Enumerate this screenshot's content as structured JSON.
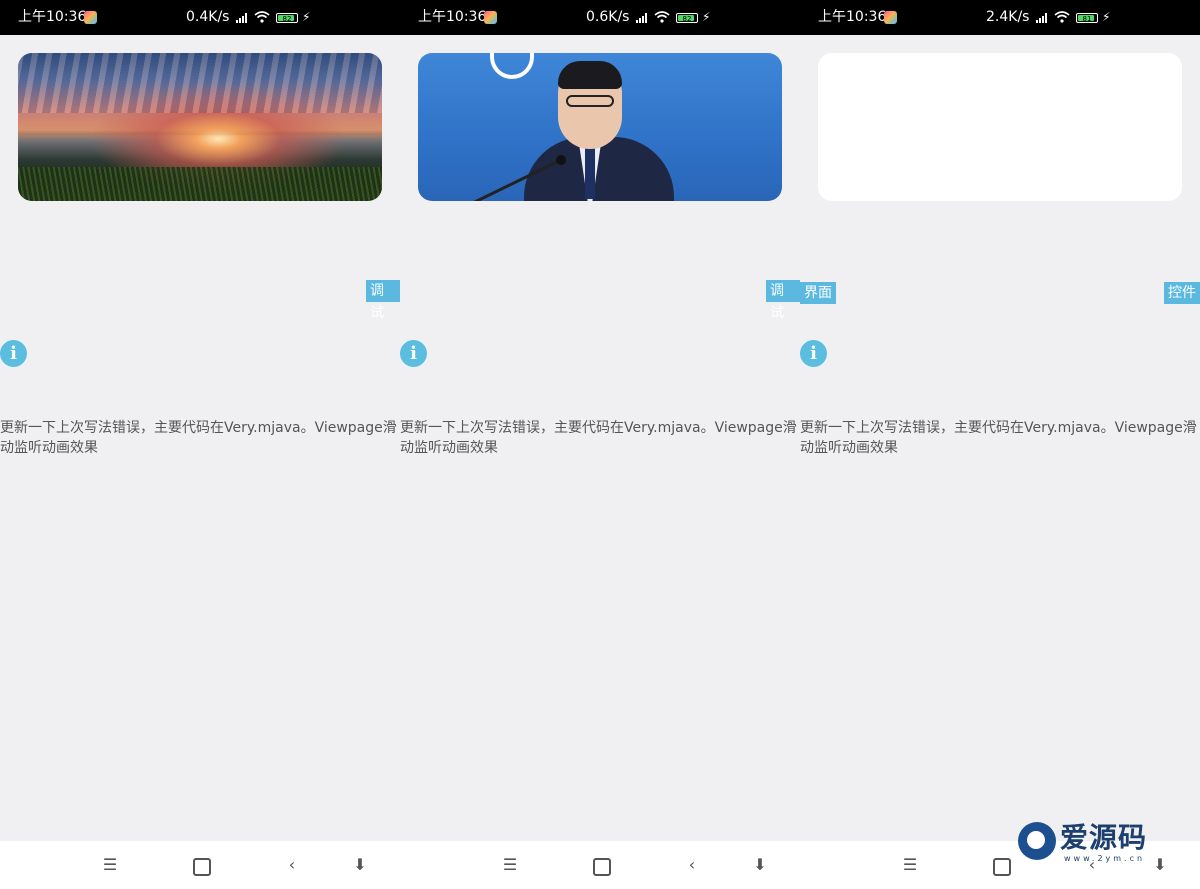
{
  "panels": [
    {
      "status": {
        "time": "上午10:36",
        "speed": "0.4K/s",
        "battery": "82"
      },
      "card": {
        "image": "sunset-landscape",
        "switch_state": "on"
      },
      "tags": [
        "调试"
      ],
      "description": "更新一下上次写法错误，主要代码在Very.mjava。Viewpage滑动监听动画效果",
      "description_lines": [
        "更新一下上次写法错误，主要代码在Very.mjava。Viewpage滑",
        "动监听动画效果"
      ]
    },
    {
      "status": {
        "time": "上午10:36",
        "speed": "0.6K/s",
        "battery": "82"
      },
      "card": {
        "image": "press-conference",
        "switch_state": "on"
      },
      "tags": [
        "调试",
        "界面"
      ],
      "description_lines": [
        "更新一下上次写法错误，主要代码在Very.mjava。Viewpage滑",
        "动监听动画效果"
      ]
    },
    {
      "status": {
        "time": "上午10:36",
        "speed": "2.4K/s",
        "battery": "81"
      },
      "card": {
        "image": "blank-white",
        "switch_state": "off"
      },
      "tags": [
        "控件"
      ],
      "description_lines": [
        "更新一下上次写法错误，主要代码在Very.mjava。Viewpage滑",
        "动监听动画效果"
      ]
    }
  ],
  "nav": {
    "menu_icon": "☰",
    "back_icon": "‹",
    "down_icon": "⬇"
  },
  "icons": {
    "info": "i",
    "charge": "⚡"
  },
  "colors": {
    "accent": "#5bb9e0",
    "background": "#f0f0f3"
  },
  "watermark": {
    "text": "爱源码",
    "url": "www.2ym.cn"
  }
}
